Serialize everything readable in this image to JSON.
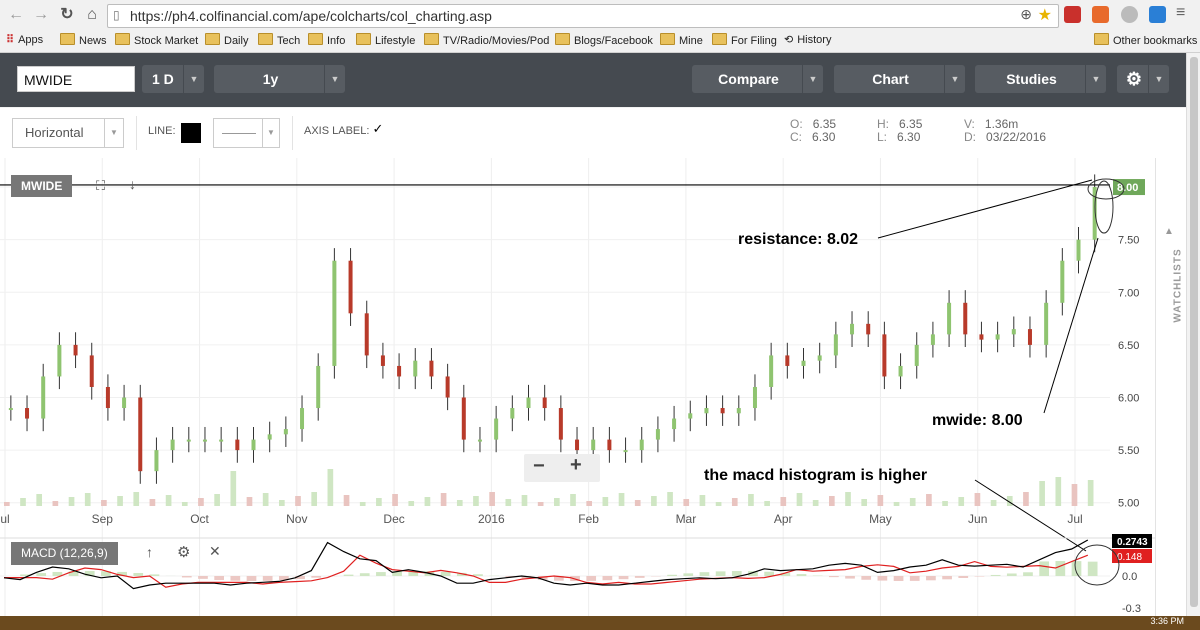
{
  "browser": {
    "url": "https://ph4.colfinancial.com/ape/colcharts/col_charting.asp",
    "bookmarks": [
      "Apps",
      "News",
      "Stock Market",
      "Daily",
      "Tech",
      "Info",
      "Lifestyle",
      "TV/Radio/Movies/Pod",
      "Blogs/Facebook",
      "Mine",
      "For Filing",
      "History"
    ],
    "other_bookmarks": "Other bookmarks",
    "time": "3:36 PM"
  },
  "toolbar": {
    "symbol": "MWIDE",
    "interval": "1 D",
    "range": "1y",
    "compare": "Compare",
    "chart": "Chart",
    "studies": "Studies"
  },
  "settings": {
    "style": "Horizontal",
    "line_label": "LINE:",
    "axis_label": "AXIS LABEL:",
    "line_color": "#000000"
  },
  "ohlc": {
    "o_label": "O:",
    "o": "6.35",
    "c_label": "C:",
    "c": "6.30",
    "h_label": "H:",
    "h": "6.35",
    "l_label": "L:",
    "l": "6.30",
    "v_label": "V:",
    "v": "1.36m",
    "d_label": "D:",
    "d": "03/22/2016"
  },
  "panel": {
    "symbol_tag": "MWIDE",
    "macd_tag": "MACD (12,26,9)",
    "watchlists": "WATCHLISTS",
    "zoom_out": "−",
    "zoom_in": "+"
  },
  "annotations": {
    "resistance": "resistance: 8.02",
    "mwide": "mwide: 8.00",
    "macd_note": "the macd histogram is higher"
  },
  "colors": {
    "up": "#8fc470",
    "down": "#b83a2a",
    "price_tag": "#6fa85a",
    "macd_line": "#000000",
    "signal_line": "#e02020"
  },
  "chart_data": [
    {
      "type": "candlestick",
      "title": "MWIDE",
      "x_tick_labels": [
        "ul",
        "Sep",
        "Oct",
        "Nov",
        "Dec",
        "2016",
        "Feb",
        "Mar",
        "Apr",
        "May",
        "Jun",
        "Jul"
      ],
      "y_ticks": [
        "8.00",
        "7.50",
        "7.00",
        "6.50",
        "6.00",
        "5.50",
        "5.00"
      ],
      "ylim": [
        4.95,
        8.2
      ],
      "last_price": "8.00",
      "resistance": 8.02,
      "approx_close_series": [
        5.9,
        5.8,
        6.2,
        6.5,
        6.4,
        6.1,
        5.9,
        6.0,
        5.3,
        5.5,
        5.6,
        5.6,
        5.6,
        5.6,
        5.5,
        5.6,
        5.65,
        5.7,
        5.9,
        6.3,
        7.3,
        6.8,
        6.4,
        6.3,
        6.2,
        6.35,
        6.2,
        6.0,
        5.6,
        5.6,
        5.8,
        5.9,
        6.0,
        5.9,
        5.6,
        5.5,
        5.6,
        5.5,
        5.5,
        5.6,
        5.7,
        5.8,
        5.85,
        5.9,
        5.85,
        5.9,
        6.1,
        6.4,
        6.3,
        6.35,
        6.4,
        6.6,
        6.7,
        6.6,
        6.2,
        6.3,
        6.5,
        6.6,
        6.9,
        6.6,
        6.55,
        6.6,
        6.65,
        6.5,
        6.9,
        7.3,
        7.5,
        8.0
      ]
    },
    {
      "type": "line",
      "title": "MACD (12,26,9)",
      "series": [
        {
          "name": "MACD",
          "color": "#000000",
          "last": "0.2743"
        },
        {
          "name": "Signal",
          "color": "#e02020",
          "last": "0.148"
        }
      ],
      "y_ticks": [
        "0.0",
        "-0.3"
      ]
    }
  ]
}
